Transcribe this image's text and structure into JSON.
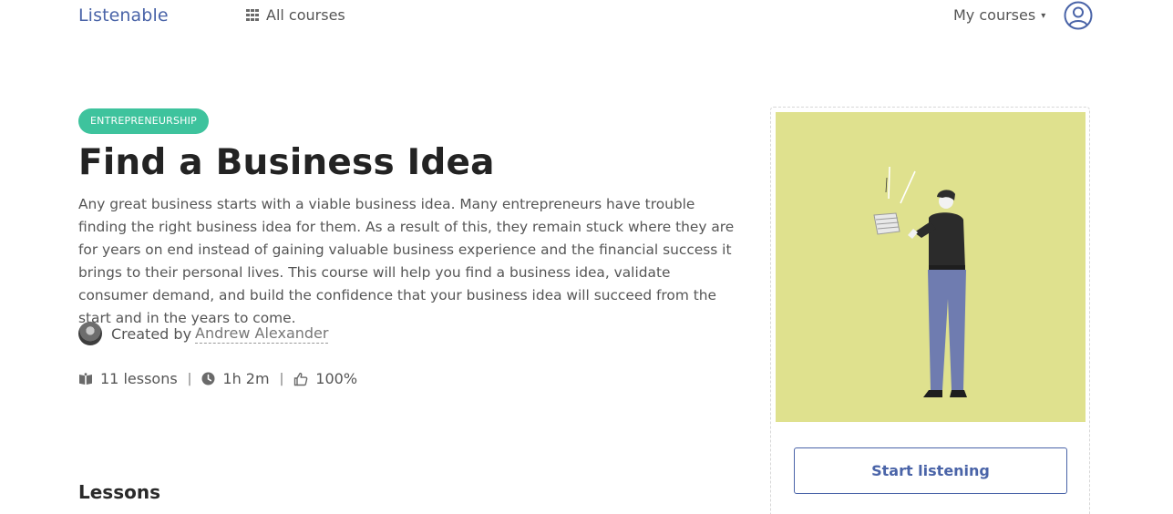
{
  "header": {
    "logo": "Listenable",
    "all_courses_label": "All courses",
    "all_courses_icon": "grid-icon",
    "my_courses_label": "My courses",
    "my_courses_icon": "chevron-down-icon",
    "profile_icon": "user-circle-icon"
  },
  "course": {
    "category": "ENTREPRENEURSHIP",
    "title": "Find a Business Idea",
    "description": "Any great business starts with a viable business idea. Many entrepreneurs have trouble finding the right business idea for them. As a result of this, they remain stuck where they are for years on end instead of gaining valuable business experience and the financial success it brings to their personal lives. This course will help you find a business idea, validate consumer demand, and build the confidence that your business idea will succeed from the start and in the years to come.",
    "created_by_label": "Created by",
    "author": "Andrew Alexander",
    "lessons": "11 lessons",
    "duration": "1h 2m",
    "rating": "100%",
    "separator": "|"
  },
  "sections": {
    "lessons_heading": "Lessons"
  },
  "card": {
    "start_button": "Start listening"
  },
  "colors": {
    "brand": "#4a64a8",
    "badge": "#3ec39d",
    "image_bg": "#dfe18e"
  }
}
